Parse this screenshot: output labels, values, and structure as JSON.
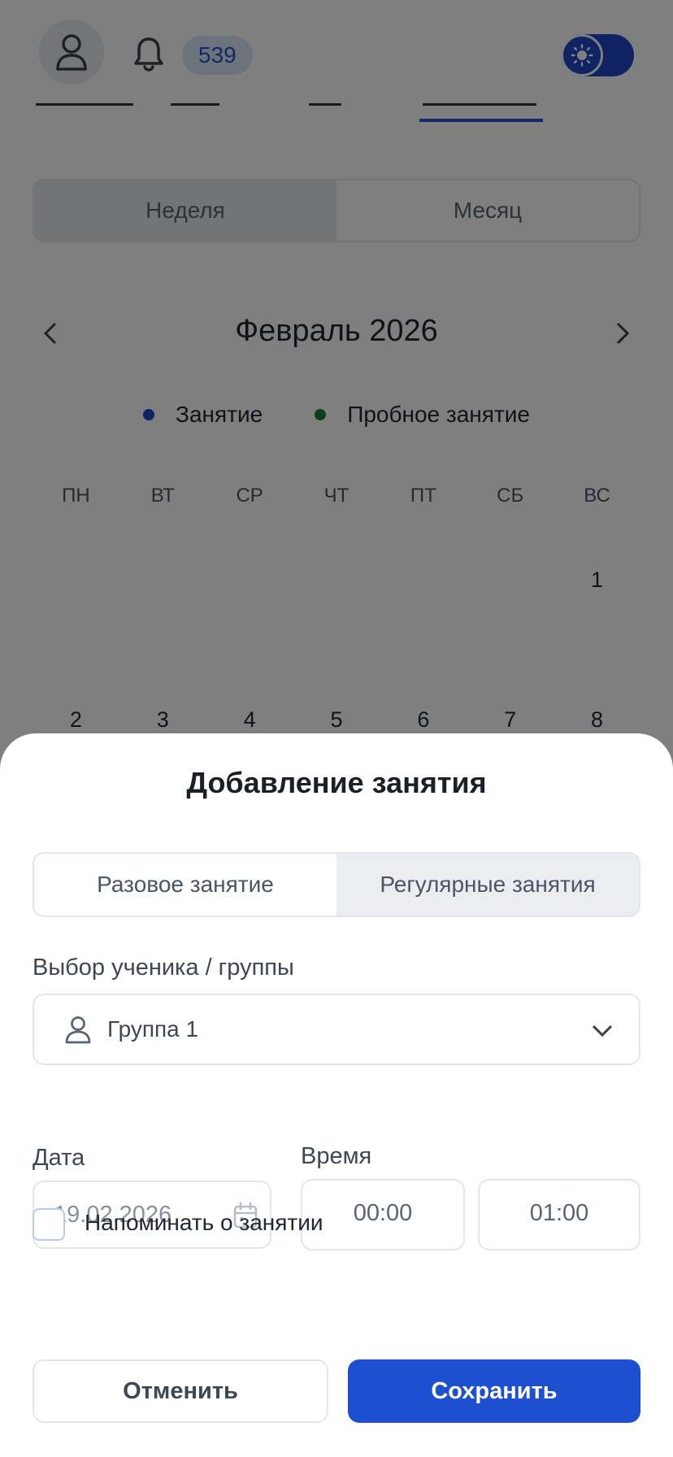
{
  "header": {
    "notifications_count": "539"
  },
  "view_toggle": {
    "week_label": "Неделя",
    "month_label": "Месяц"
  },
  "calendar": {
    "month_title": "Февраль 2026",
    "legend": [
      {
        "label": "Занятие",
        "color": "#1e44c6"
      },
      {
        "label": "Пробное занятие",
        "color": "#1c7c3c"
      }
    ],
    "weekdays": [
      "ПН",
      "ВТ",
      "СР",
      "ЧТ",
      "ПТ",
      "СБ",
      "ВС"
    ],
    "weeks": [
      [
        "",
        "",
        "",
        "",
        "",
        "",
        "1"
      ],
      [
        "2",
        "3",
        "4",
        "5",
        "6",
        "7",
        "8"
      ]
    ]
  },
  "sheet": {
    "title": "Добавление занятия",
    "type_tabs": {
      "single": "Разовое занятие",
      "regular": "Регулярные занятия"
    },
    "student_label": "Выбор ученика / группы",
    "student_value": "Группа 1",
    "date_label": "Дата",
    "date_value": "19.02.2026",
    "time_label": "Время",
    "time_start": "00:00",
    "time_end": "01:00",
    "reminder_label": "Напоминать о занятии",
    "cancel_label": "Отменить",
    "save_label": "Сохранить"
  },
  "colors": {
    "accent": "#1e4fd1",
    "badge_bg": "#dbe6fb"
  }
}
